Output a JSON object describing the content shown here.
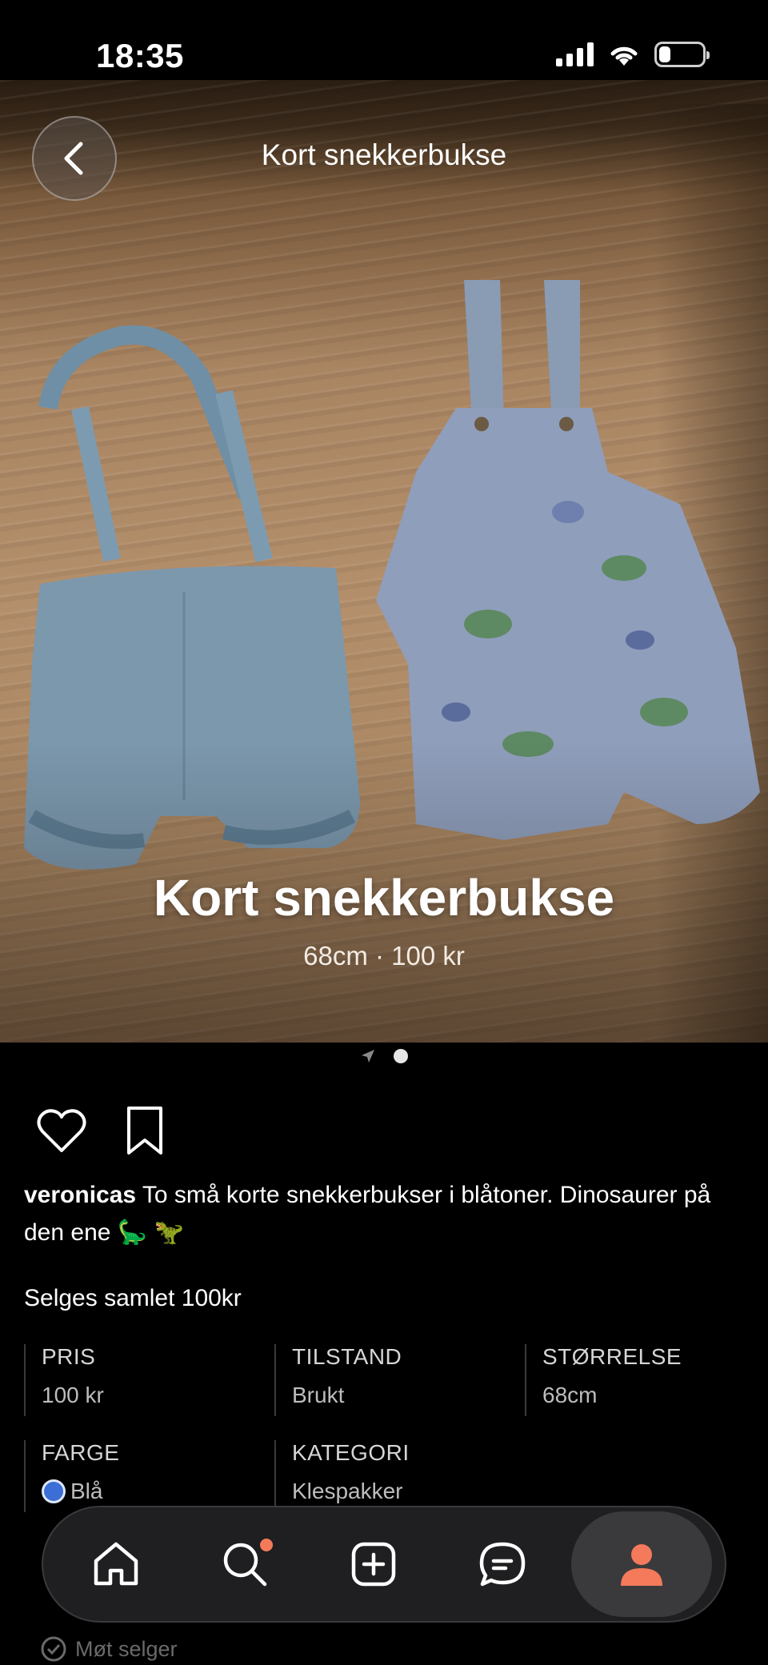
{
  "status_bar": {
    "time": "18:35"
  },
  "header": {
    "title": "Kort snekkerbukse",
    "back_icon": "chevron-left-icon"
  },
  "hero": {
    "title": "Kort snekkerbukse",
    "subtitle": "68cm · 100 kr"
  },
  "gallery": {
    "indicators": [
      "location-arrow-icon",
      "page-dot"
    ]
  },
  "actions": {
    "like_icon": "heart-icon",
    "save_icon": "bookmark-icon"
  },
  "post": {
    "username": "veronicas",
    "caption": "To små korte snekkerbukser i blåtoner. Dinosaurer på den ene 🦕 🦖",
    "note": "Selges samlet 100kr"
  },
  "attributes": {
    "price": {
      "label": "PRIS",
      "value": "100 kr"
    },
    "condition": {
      "label": "TILSTAND",
      "value": "Brukt"
    },
    "size": {
      "label": "STØRRELSE",
      "value": "68cm"
    },
    "color": {
      "label": "FARGE",
      "value": "Blå",
      "swatch": "#3b6fd6"
    },
    "category": {
      "label": "KATEGORI",
      "value": "Klespakker"
    }
  },
  "delivery": {
    "option": "Møt selger"
  },
  "tabbar": {
    "items": [
      "home-icon",
      "search-icon",
      "add-icon",
      "messages-icon",
      "profile-icon"
    ],
    "active": "profile-icon",
    "accent": "#f47a5b"
  }
}
